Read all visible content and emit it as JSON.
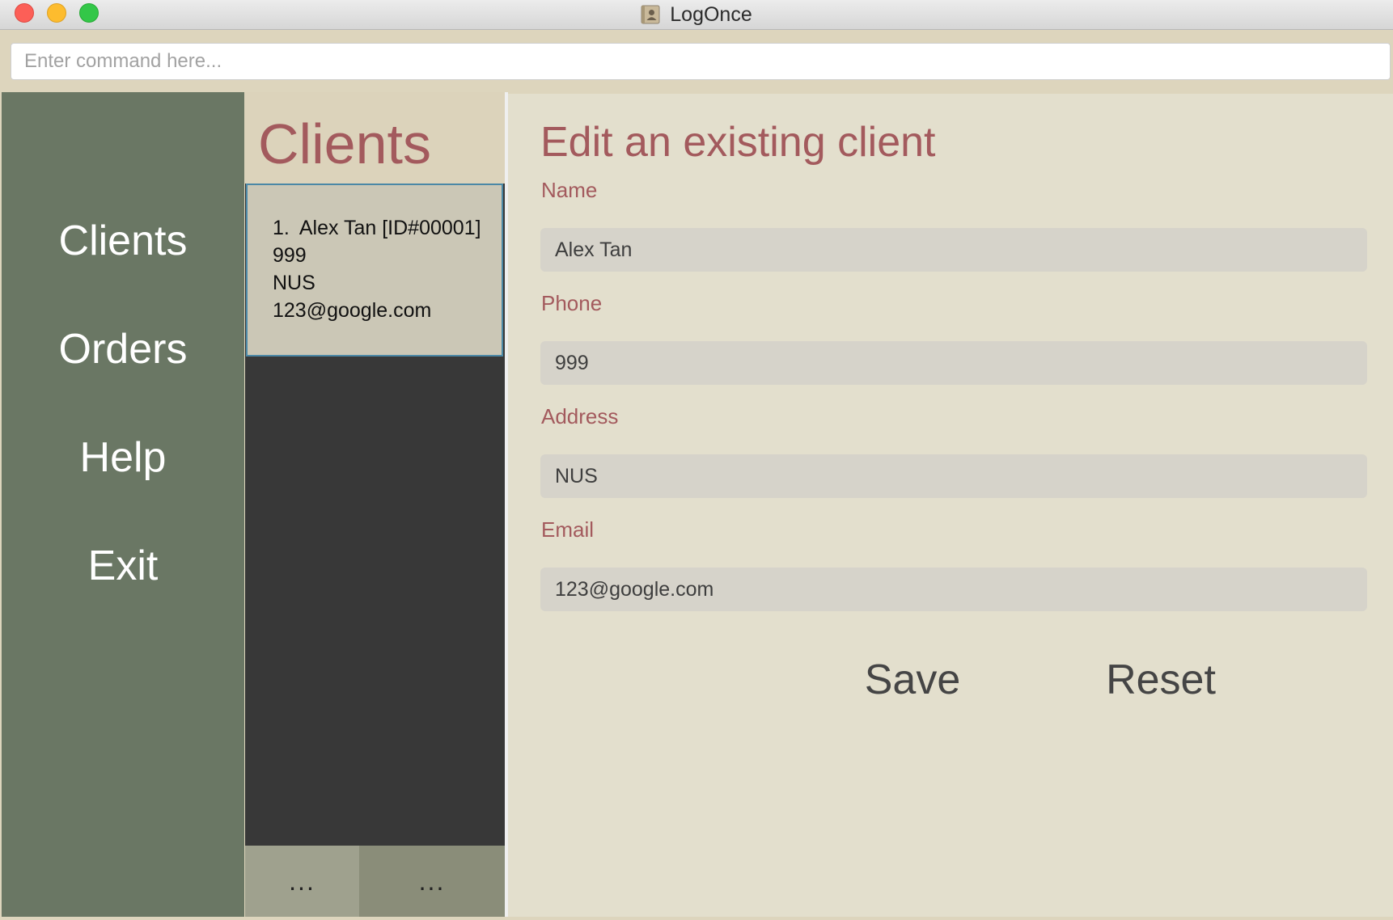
{
  "window": {
    "title": "LogOnce",
    "app_icon": "address-book-icon",
    "controls": [
      "close",
      "minimize",
      "zoom"
    ]
  },
  "command_bar": {
    "placeholder": "Enter command here...",
    "value": ""
  },
  "sidebar": {
    "items": [
      {
        "label": "Clients"
      },
      {
        "label": "Orders"
      },
      {
        "label": "Help"
      },
      {
        "label": "Exit"
      }
    ]
  },
  "client_list": {
    "title": "Clients",
    "clients": [
      {
        "index": "1.",
        "name_id": "Alex Tan [ID#00001]",
        "phone": "999",
        "address": "NUS",
        "email": "123@google.com"
      }
    ],
    "pagination": {
      "prev": "...",
      "next": "..."
    }
  },
  "editor": {
    "title": "Edit an existing client",
    "fields": [
      {
        "label": "Name",
        "value": "Alex Tan"
      },
      {
        "label": "Phone",
        "value": "999"
      },
      {
        "label": "Address",
        "value": "NUS"
      },
      {
        "label": "Email",
        "value": "123@google.com"
      }
    ],
    "save_label": "Save",
    "reset_label": "Reset"
  },
  "colors": {
    "accent": "#a35a5d",
    "sidebar_bg": "#6a7764",
    "list_bg": "#383838",
    "editor_bg": "#e3dfcd",
    "selected_border": "#4b88a6"
  }
}
